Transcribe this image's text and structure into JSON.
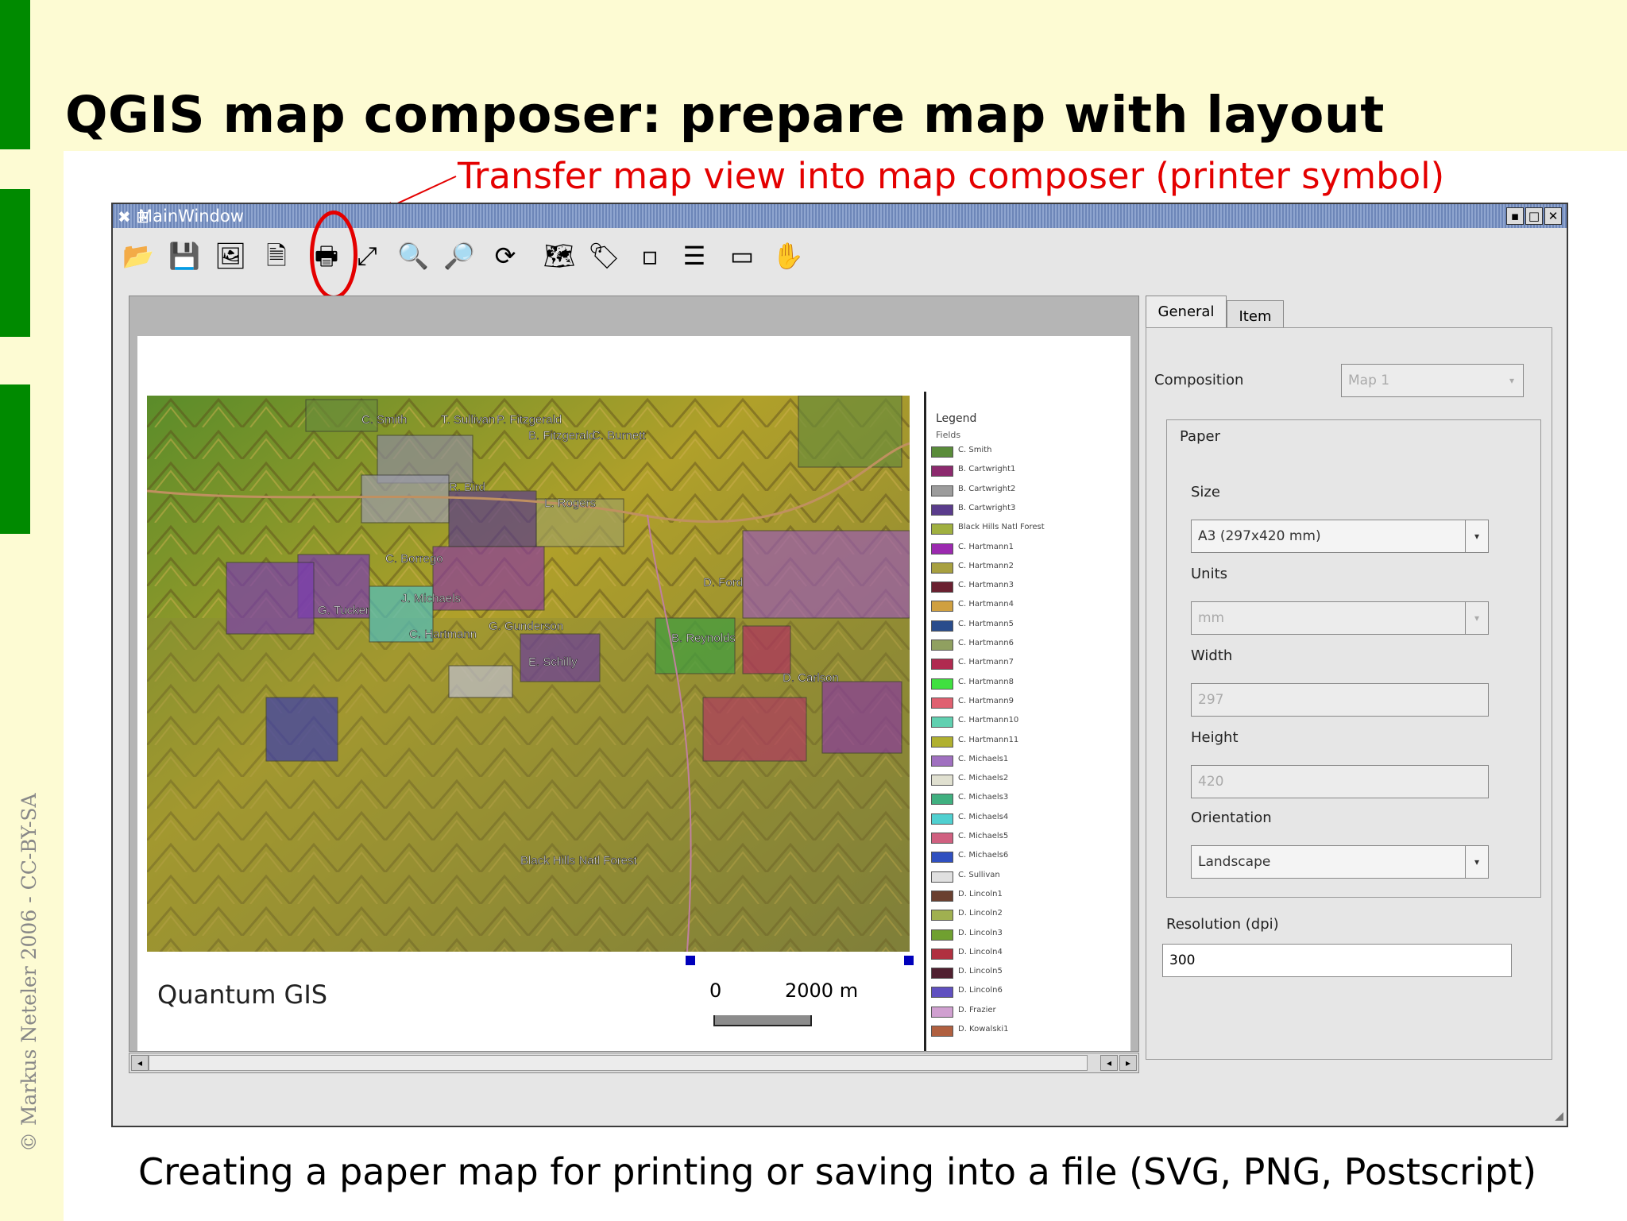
{
  "slide": {
    "title": "QGIS map composer: prepare map with layout",
    "annotation": "Transfer map view into map composer (printer symbol)",
    "caption": "Creating a paper map for printing or saving into a file (SVG, PNG, Postscript)",
    "copyright": "© Markus Neteler 2006 - CC-BY-SA",
    "accent_color": "#008a00",
    "annotation_color": "#e40000",
    "band_color": "#fdfbd3"
  },
  "window": {
    "title": "MainWindow",
    "controls": [
      "▪",
      "□",
      "✕"
    ]
  },
  "toolbar": {
    "icons": [
      "open-icon",
      "save-icon",
      "export-image-icon",
      "export-svg-icon",
      "print-icon",
      "zoom-full-icon",
      "zoom-in-icon",
      "zoom-out-icon",
      "refresh-icon",
      "add-map-icon",
      "add-label-icon",
      "add-image-icon",
      "add-legend-icon",
      "add-scalebar-icon",
      "pan-icon"
    ],
    "glyphs": [
      "📂",
      "💾",
      "🖼",
      "🗎",
      "🖶",
      "⤢",
      "🔍",
      "🔎",
      "⟳",
      "🗺",
      "🏷",
      "▫",
      "☰",
      "▭",
      "✋"
    ]
  },
  "map": {
    "place_labels": [
      "C. Smith",
      "T. Sullivan",
      "P. Fitzgerald",
      "B. Fitzgerald",
      "C. Burnett",
      "R. Bird",
      "L. Rogers",
      "C. Borrego",
      "J. Michaels",
      "G. Tucker",
      "C. Hartmann",
      "D. Ford",
      "G. Gunderson",
      "B. Reynolds",
      "E. Schilly",
      "D. Carlson",
      "Black Hills Natl Forest"
    ],
    "company": "Quantum GIS",
    "scale_zero": "0",
    "scale_end": "2000 m"
  },
  "legend": {
    "title": "Legend",
    "subtitle": "Fields",
    "items": [
      {
        "label": "C. Smith",
        "color": "#5a8c3a"
      },
      {
        "label": "B. Cartwright1",
        "color": "#8c2a6e"
      },
      {
        "label": "B. Cartwright2",
        "color": "#9c9c9c"
      },
      {
        "label": "B. Cartwright3",
        "color": "#5a3c8c"
      },
      {
        "label": "Black Hills Natl Forest",
        "color": "#a0b040"
      },
      {
        "label": "C. Hartmann1",
        "color": "#9c2ab0"
      },
      {
        "label": "C. Hartmann2",
        "color": "#a8a040"
      },
      {
        "label": "C. Hartmann3",
        "color": "#6a2030"
      },
      {
        "label": "C. Hartmann4",
        "color": "#d0a040"
      },
      {
        "label": "C. Hartmann5",
        "color": "#2a4c8c"
      },
      {
        "label": "C. Hartmann6",
        "color": "#90a060"
      },
      {
        "label": "C. Hartmann7",
        "color": "#b02a50"
      },
      {
        "label": "C. Hartmann8",
        "color": "#40e040"
      },
      {
        "label": "C. Hartmann9",
        "color": "#e06070"
      },
      {
        "label": "C. Hartmann10",
        "color": "#60d0b0"
      },
      {
        "label": "C. Hartmann11",
        "color": "#b0b030"
      },
      {
        "label": "C. Michaels1",
        "color": "#a070c0"
      },
      {
        "label": "C. Michaels2",
        "color": "#e0e0d0"
      },
      {
        "label": "C. Michaels3",
        "color": "#40b080"
      },
      {
        "label": "C. Michaels4",
        "color": "#50d0d0"
      },
      {
        "label": "C. Michaels5",
        "color": "#d06080"
      },
      {
        "label": "C. Michaels6",
        "color": "#3050c0"
      },
      {
        "label": "C. Sullivan",
        "color": "#e0e0e0"
      },
      {
        "label": "D. Lincoln1",
        "color": "#6a4030"
      },
      {
        "label": "D. Lincoln2",
        "color": "#a0b050"
      },
      {
        "label": "D. Lincoln3",
        "color": "#70a030"
      },
      {
        "label": "D. Lincoln4",
        "color": "#b03040"
      },
      {
        "label": "D. Lincoln5",
        "color": "#502030"
      },
      {
        "label": "D. Lincoln6",
        "color": "#6050c0"
      },
      {
        "label": "D. Frazier",
        "color": "#d0a0d0"
      },
      {
        "label": "D. Kowalski1",
        "color": "#b06040"
      }
    ]
  },
  "panel": {
    "tabs": [
      "General",
      "Item"
    ],
    "composition_label": "Composition",
    "composition_value": "Map 1",
    "paper_group": "Paper",
    "size_label": "Size",
    "size_value": "A3 (297x420 mm)",
    "units_label": "Units",
    "units_value": "mm",
    "width_label": "Width",
    "width_value": "297",
    "height_label": "Height",
    "height_value": "420",
    "orientation_label": "Orientation",
    "orientation_value": "Landscape",
    "resolution_label": "Resolution (dpi)",
    "resolution_value": "300"
  }
}
